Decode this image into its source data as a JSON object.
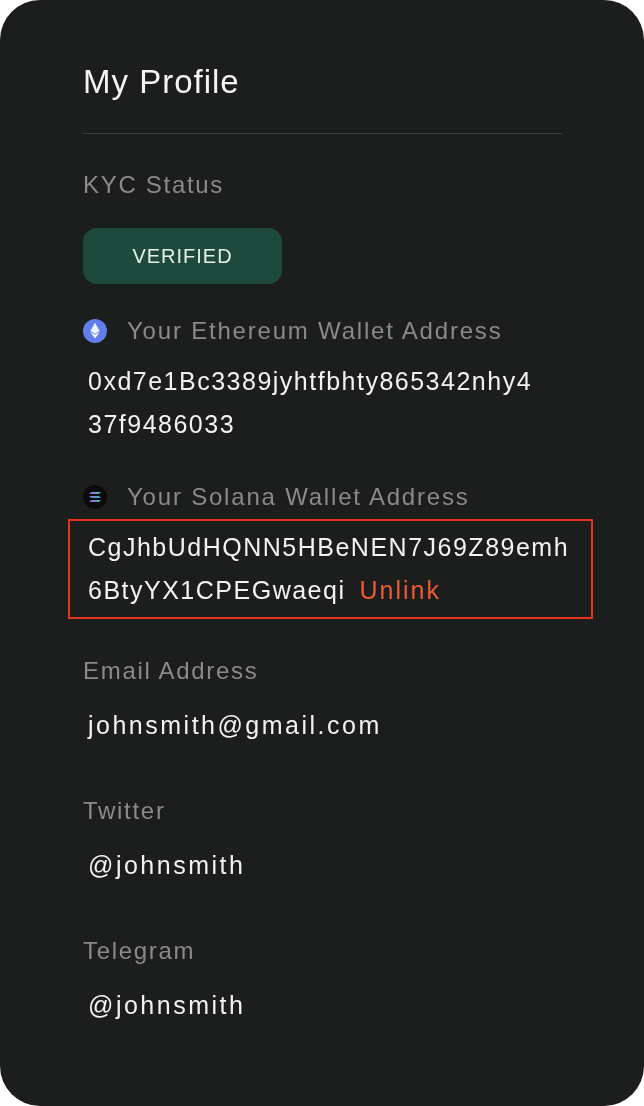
{
  "title": "My Profile",
  "kyc": {
    "label": "KYC Status",
    "status": "VERIFIED"
  },
  "wallets": [
    {
      "kind": "ethereum",
      "label": "Your Ethereum Wallet Address",
      "address_lines": [
        "0xd7e1Bc3389jyhtfbhty865342nhy4",
        "37f9486033"
      ],
      "highlighted": false
    },
    {
      "kind": "solana",
      "label": "Your Solana Wallet Address",
      "address_lines": [
        "CgJhbUdHQNN5HBeNEN7J69Z89emh",
        "6BtyYX1CPEGwaeqi"
      ],
      "action": "Unlink",
      "highlighted": true
    }
  ],
  "fields": [
    {
      "label": "Email Address",
      "value": "johnsmith@gmail.com"
    },
    {
      "label": "Twitter",
      "value": "@johnsmith"
    },
    {
      "label": "Telegram",
      "value": "@johnsmith"
    }
  ]
}
